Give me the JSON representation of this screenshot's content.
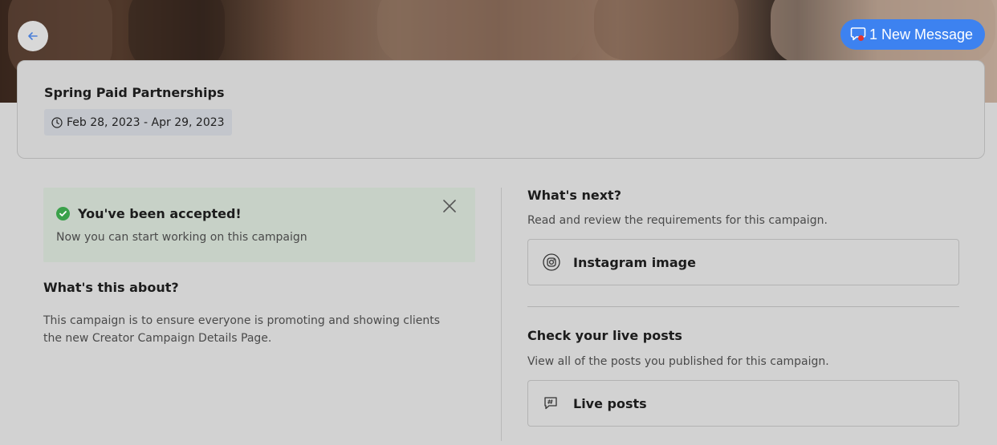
{
  "header": {
    "back_icon": "arrow-left-icon",
    "new_message_label": "1 New Message",
    "message_icon": "chat-bubble-icon",
    "accent_color": "#3d82f0"
  },
  "campaign": {
    "title": "Spring Paid Partnerships",
    "date_range": "Feb 28, 2023 - Apr 29, 2023",
    "date_icon": "clock-icon"
  },
  "acceptance": {
    "title": "You've been accepted!",
    "subtitle": "Now you can start working on this campaign",
    "status_color": "#3aa14a"
  },
  "about": {
    "heading": "What's this about?",
    "body": "This campaign is to ensure everyone is promoting and showing clients the new Creator Campaign Details Page."
  },
  "next": {
    "heading": "What's next?",
    "description": "Read and review the requirements for this campaign.",
    "requirement_label": "Instagram image",
    "requirement_icon": "instagram-icon"
  },
  "live_posts": {
    "heading": "Check your live posts",
    "description": "View all of the posts you published for this campaign.",
    "button_label": "Live posts",
    "button_icon": "hashtag-message-icon"
  }
}
